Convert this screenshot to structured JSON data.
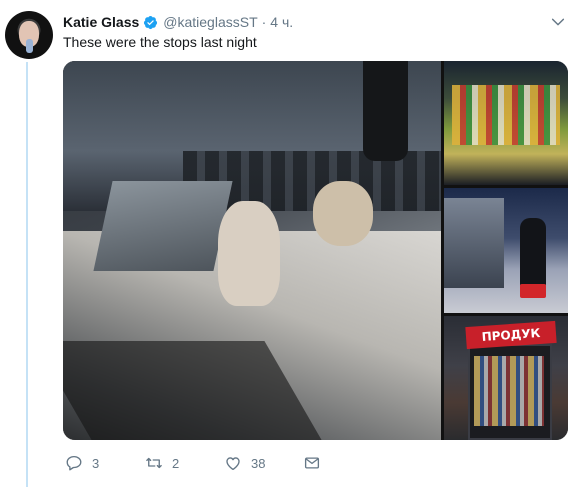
{
  "tweet": {
    "author_name": "Katie Glass",
    "handle": "@katieglassST",
    "separator": "·",
    "time": "4 ч.",
    "text": "These were the stops last night",
    "verified": true
  },
  "media": {
    "kiosk_sign": "ПРОДУК"
  },
  "actions": {
    "reply_count": "3",
    "retweet_count": "2",
    "like_count": "38"
  },
  "colors": {
    "accent": "#1da1f2",
    "secondary_text": "#657786",
    "thread_line": "#c5e2f6"
  }
}
